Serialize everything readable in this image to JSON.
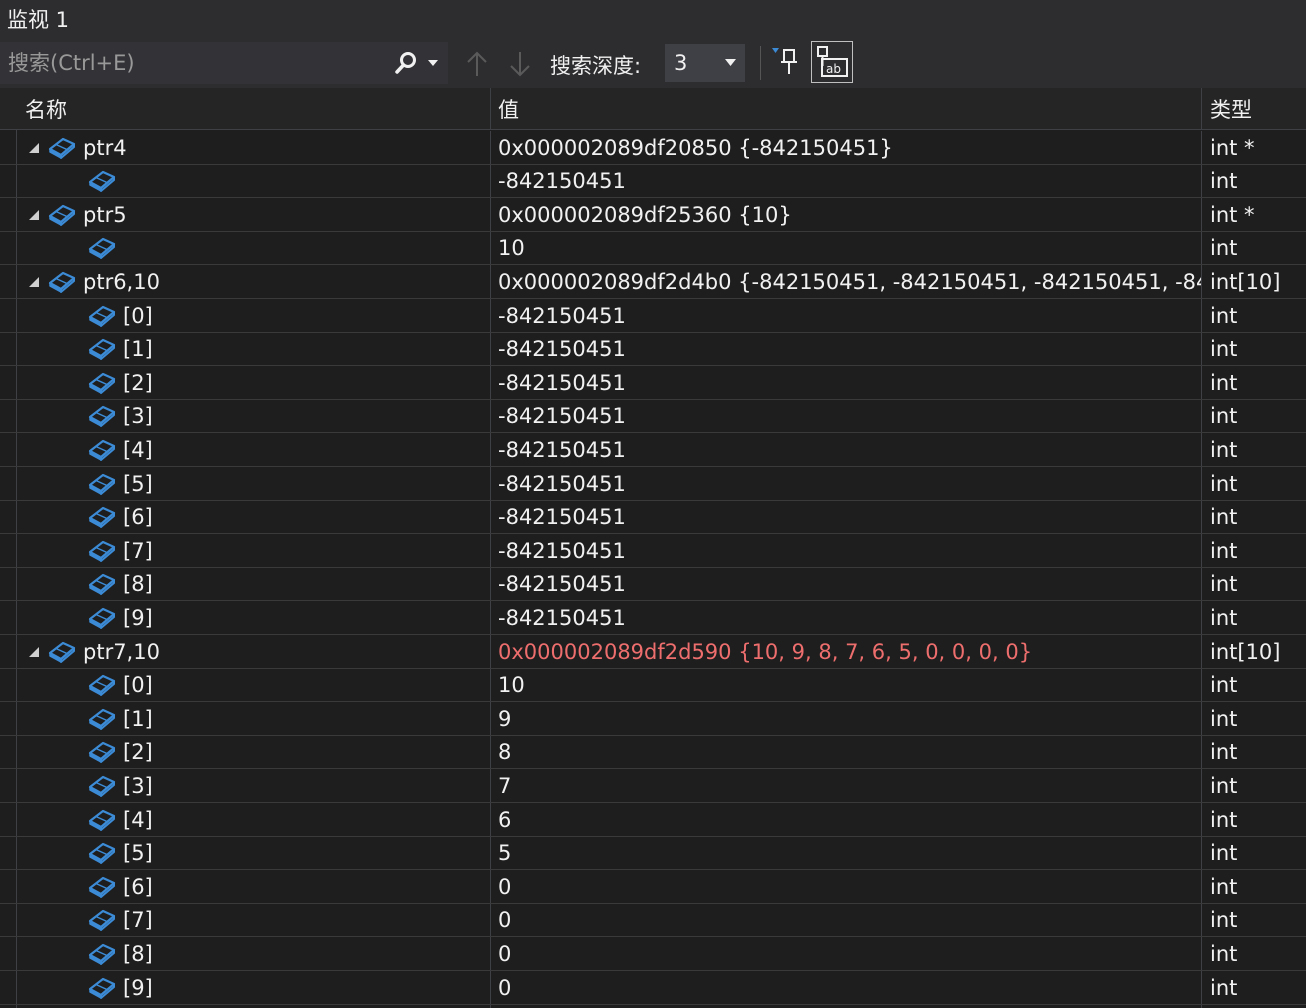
{
  "window": {
    "title": "监视 1"
  },
  "toolbar": {
    "search_placeholder": "搜索(Ctrl+E)",
    "depth_label": "搜索深度:",
    "depth_value": "3"
  },
  "columns": {
    "name": "名称",
    "value": "值",
    "type": "类型"
  },
  "rows": [
    {
      "level": 0,
      "expanded": true,
      "name": "ptr4",
      "value": "0x000002089df20850 {-842150451}",
      "type": "int *",
      "changed": false
    },
    {
      "level": 1,
      "expanded": false,
      "name": "",
      "value": "-842150451",
      "type": "int",
      "changed": false
    },
    {
      "level": 0,
      "expanded": true,
      "name": "ptr5",
      "value": "0x000002089df25360 {10}",
      "type": "int *",
      "changed": false
    },
    {
      "level": 1,
      "expanded": false,
      "name": "",
      "value": "10",
      "type": "int",
      "changed": false
    },
    {
      "level": 0,
      "expanded": true,
      "name": "ptr6,10",
      "value": "0x000002089df2d4b0 {-842150451, -842150451, -842150451, -84...",
      "type": "int[10]",
      "changed": false
    },
    {
      "level": 1,
      "expanded": false,
      "name": "[0]",
      "value": "-842150451",
      "type": "int",
      "changed": false
    },
    {
      "level": 1,
      "expanded": false,
      "name": "[1]",
      "value": "-842150451",
      "type": "int",
      "changed": false
    },
    {
      "level": 1,
      "expanded": false,
      "name": "[2]",
      "value": "-842150451",
      "type": "int",
      "changed": false
    },
    {
      "level": 1,
      "expanded": false,
      "name": "[3]",
      "value": "-842150451",
      "type": "int",
      "changed": false
    },
    {
      "level": 1,
      "expanded": false,
      "name": "[4]",
      "value": "-842150451",
      "type": "int",
      "changed": false
    },
    {
      "level": 1,
      "expanded": false,
      "name": "[5]",
      "value": "-842150451",
      "type": "int",
      "changed": false
    },
    {
      "level": 1,
      "expanded": false,
      "name": "[6]",
      "value": "-842150451",
      "type": "int",
      "changed": false
    },
    {
      "level": 1,
      "expanded": false,
      "name": "[7]",
      "value": "-842150451",
      "type": "int",
      "changed": false
    },
    {
      "level": 1,
      "expanded": false,
      "name": "[8]",
      "value": "-842150451",
      "type": "int",
      "changed": false
    },
    {
      "level": 1,
      "expanded": false,
      "name": "[9]",
      "value": "-842150451",
      "type": "int",
      "changed": false
    },
    {
      "level": 0,
      "expanded": true,
      "name": "ptr7,10",
      "value": "0x000002089df2d590 {10, 9, 8, 7, 6, 5, 0, 0, 0, 0}",
      "type": "int[10]",
      "changed": true
    },
    {
      "level": 1,
      "expanded": false,
      "name": "[0]",
      "value": "10",
      "type": "int",
      "changed": false
    },
    {
      "level": 1,
      "expanded": false,
      "name": "[1]",
      "value": "9",
      "type": "int",
      "changed": false
    },
    {
      "level": 1,
      "expanded": false,
      "name": "[2]",
      "value": "8",
      "type": "int",
      "changed": false
    },
    {
      "level": 1,
      "expanded": false,
      "name": "[3]",
      "value": "7",
      "type": "int",
      "changed": false
    },
    {
      "level": 1,
      "expanded": false,
      "name": "[4]",
      "value": "6",
      "type": "int",
      "changed": false
    },
    {
      "level": 1,
      "expanded": false,
      "name": "[5]",
      "value": "5",
      "type": "int",
      "changed": false
    },
    {
      "level": 1,
      "expanded": false,
      "name": "[6]",
      "value": "0",
      "type": "int",
      "changed": false
    },
    {
      "level": 1,
      "expanded": false,
      "name": "[7]",
      "value": "0",
      "type": "int",
      "changed": false
    },
    {
      "level": 1,
      "expanded": false,
      "name": "[8]",
      "value": "0",
      "type": "int",
      "changed": false
    },
    {
      "level": 1,
      "expanded": false,
      "name": "[9]",
      "value": "0",
      "type": "int",
      "changed": false
    }
  ],
  "colors": {
    "changed_value": "#ee6e6e",
    "object_icon": "#3c8bd6"
  },
  "icons": {
    "expander": "expanded-triangle-icon",
    "object": "object-cube-icon",
    "search": "search-icon",
    "pin": "pin-icon",
    "hex": "hex-display-icon"
  }
}
